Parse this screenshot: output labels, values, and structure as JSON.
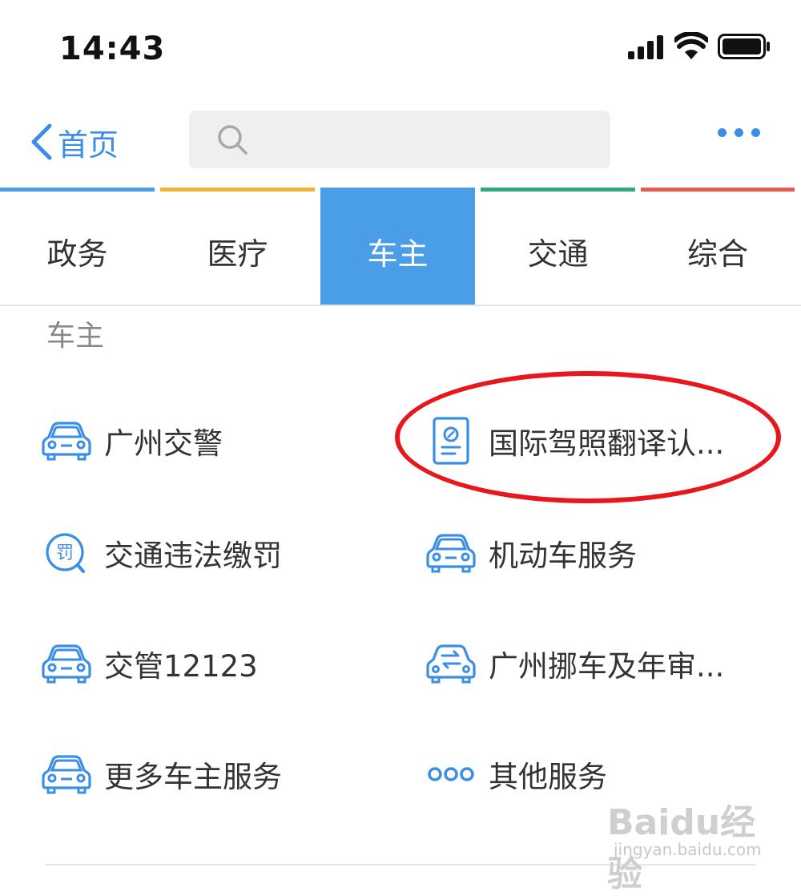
{
  "status_bar": {
    "time": "14:43"
  },
  "nav": {
    "back_label": "首页",
    "search_placeholder": ""
  },
  "tabs": [
    {
      "label": "政务",
      "color": "#4a9ee8"
    },
    {
      "label": "医疗",
      "color": "#f2b233"
    },
    {
      "label": "车主",
      "color": "#4a9ee8",
      "active": true
    },
    {
      "label": "交通",
      "color": "#2eaa7c"
    },
    {
      "label": "综合",
      "color": "#e85a4f"
    }
  ],
  "section": {
    "title": "车主",
    "items": [
      {
        "label": "广州交警",
        "icon": "car-icon"
      },
      {
        "label": "国际驾照翻译认...",
        "icon": "document-icon"
      },
      {
        "label": "交通违法缴罚",
        "icon": "fine-search-icon"
      },
      {
        "label": "机动车服务",
        "icon": "car-icon"
      },
      {
        "label": "交管12123",
        "icon": "car-icon"
      },
      {
        "label": "广州挪车及年审...",
        "icon": "car-swap-icon"
      },
      {
        "label": "更多车主服务",
        "icon": "car-icon"
      },
      {
        "label": "其他服务",
        "icon": "more-dots-icon"
      }
    ]
  },
  "icon_glyphs": {
    "fine": "罚"
  },
  "watermark": {
    "logo": "Baidu经验",
    "url": "jingyan.baidu.com"
  },
  "colors": {
    "accent": "#3a8ee6",
    "active_tab": "#4a9ee8",
    "highlight": "#e8171c"
  }
}
